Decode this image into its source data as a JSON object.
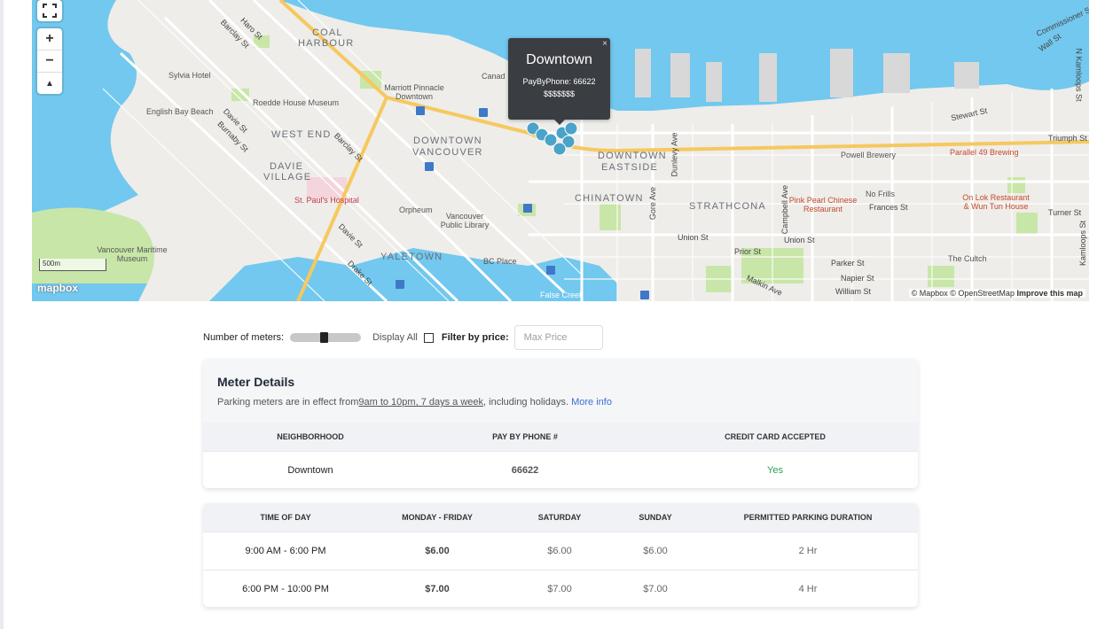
{
  "map": {
    "districts": [
      "COAL",
      "HARBOUR",
      "WEST END",
      "DAVIE",
      "VILLAGE",
      "DOWNTOWN",
      "VANCOUVER",
      "DOWNTOWN",
      "EASTSIDE",
      "CHINATOWN",
      "STRATHCONA",
      "YALETOWN"
    ],
    "streets": [
      "Haro St",
      "Barclay St",
      "Davie St",
      "Burnaby St",
      "Barclay St",
      "Davie St",
      "Drake St",
      "Stewart St",
      "Triumph St",
      "Dunlevy Ave",
      "Gore Ave",
      "Union St",
      "Union St",
      "Campbell Ave",
      "Prior St",
      "Parker St",
      "Napier St",
      "William St",
      "Malkin Ave",
      "Turner St",
      "Frances St",
      "Commissioner St",
      "Wall St",
      "N Kamloops St",
      "Kamloops St",
      "N Kamloops St"
    ],
    "pois": [
      "Sylvia Hotel",
      "English Bay Beach",
      "Roedde House Museum",
      "Marriott Pinnacle Downtown",
      "St. Paul's Hospital",
      "Orpheum",
      "Vancouver Public Library",
      "BC Place",
      "Vancouver Maritime Museum",
      "Powell Brewery",
      "Parallel 49 Brewing",
      "No Frills",
      "Pink Pearl Chinese Restaurant",
      "On Lok Restaurant & Wun Tun House",
      "The Cultch",
      "Canad",
      "False Creek"
    ],
    "scale_label": "500m",
    "logo_text": "mapbox",
    "attribution": "© Mapbox © OpenStreetMap",
    "improve_link": "Improve this map",
    "controls": {
      "fullscreen_icon": "fullscreen-icon",
      "zoom_in": "+",
      "zoom_out": "−",
      "compass": "▲"
    },
    "popup": {
      "title": "Downtown",
      "line": "PayByPhone: 66622",
      "price": "$$$$$$$",
      "close": "×"
    },
    "colors": {
      "water": "#72c8ee",
      "park": "#c8e6a8",
      "major_road": "#f6c85f",
      "popup": "#3a3d42",
      "marker": "#4aa3c8"
    }
  },
  "controls": {
    "meters_label": "Number of meters:",
    "meters_fraction": 0.45,
    "display_all_label": "Display All",
    "filter_label": "Filter by price:",
    "price_placeholder": "Max Price"
  },
  "meter_details": {
    "title": "Meter Details",
    "desc_prefix": "Parking meters are in effect from",
    "hours": "9am to 10pm, 7 days a week",
    "desc_suffix": ", including holidays. ",
    "more_info": "More info",
    "columns": [
      "NEIGHBORHOOD",
      "PAY BY PHONE #",
      "CREDIT CARD ACCEPTED"
    ],
    "row": {
      "neighborhood": "Downtown",
      "phone": "66622",
      "credit": "Yes"
    },
    "credit_color": "#2e9e5b"
  },
  "rates": {
    "columns": [
      "TIME OF DAY",
      "MONDAY - FRIDAY",
      "SATURDAY",
      "SUNDAY",
      "PERMITTED PARKING DURATION"
    ],
    "rows": [
      {
        "time": "9:00 AM - 6:00 PM",
        "weekday": "$6.00",
        "saturday": "$6.00",
        "sunday": "$6.00",
        "duration": "2 Hr"
      },
      {
        "time": "6:00 PM - 10:00 PM",
        "weekday": "$7.00",
        "saturday": "$7.00",
        "sunday": "$7.00",
        "duration": "4 Hr"
      }
    ]
  }
}
